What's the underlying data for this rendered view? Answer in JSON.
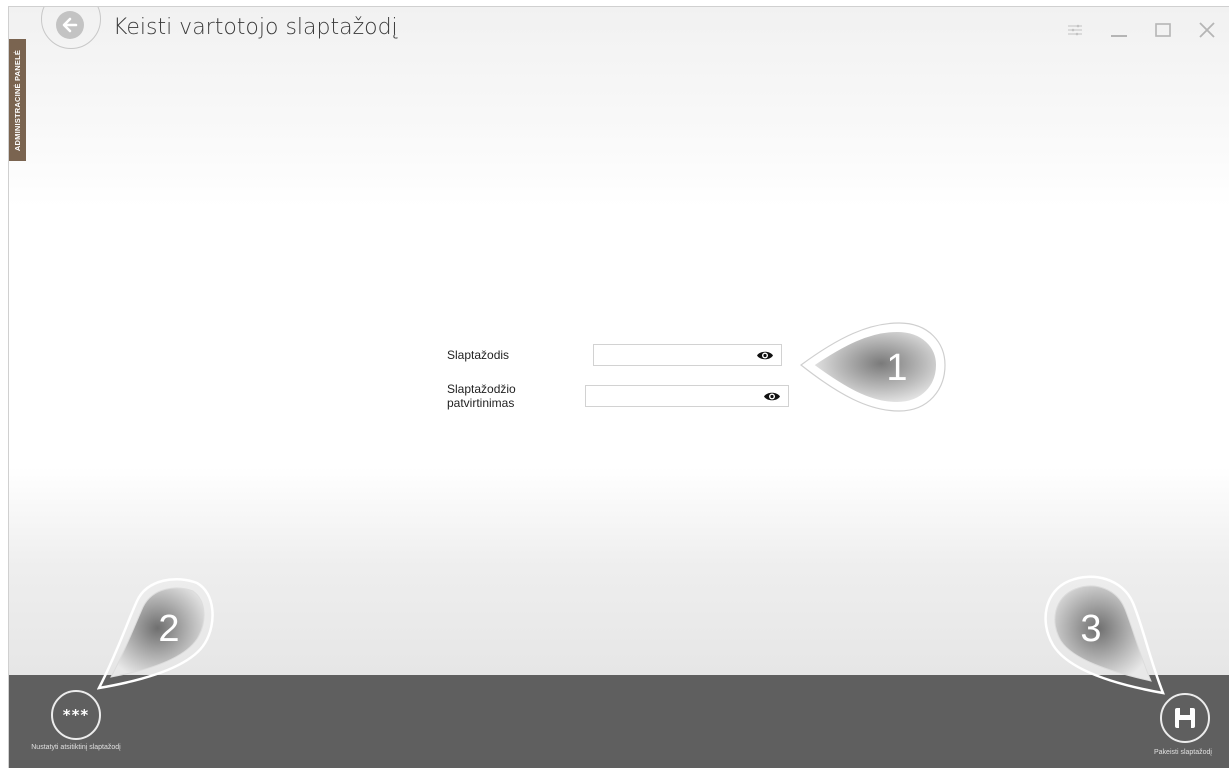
{
  "window": {
    "title": "Keisti vartotojo slaptažodį",
    "side_tab_label": "ADMINISTRACINĖ PANELĖ",
    "controls": [
      "settings-icon",
      "minimize-icon",
      "maximize-icon",
      "close-icon"
    ]
  },
  "form": {
    "password_label": "Slaptažodis",
    "password_value": "",
    "confirm_label": "Slaptažodžio patvirtinimas",
    "confirm_value": ""
  },
  "bottom_bar": {
    "generate_label": "Nustatyti atsitiktinį slaptažodį",
    "generate_icon_text": "***",
    "save_label": "Pakeisti slaptažodį"
  },
  "callouts": [
    "1",
    "2",
    "3"
  ]
}
